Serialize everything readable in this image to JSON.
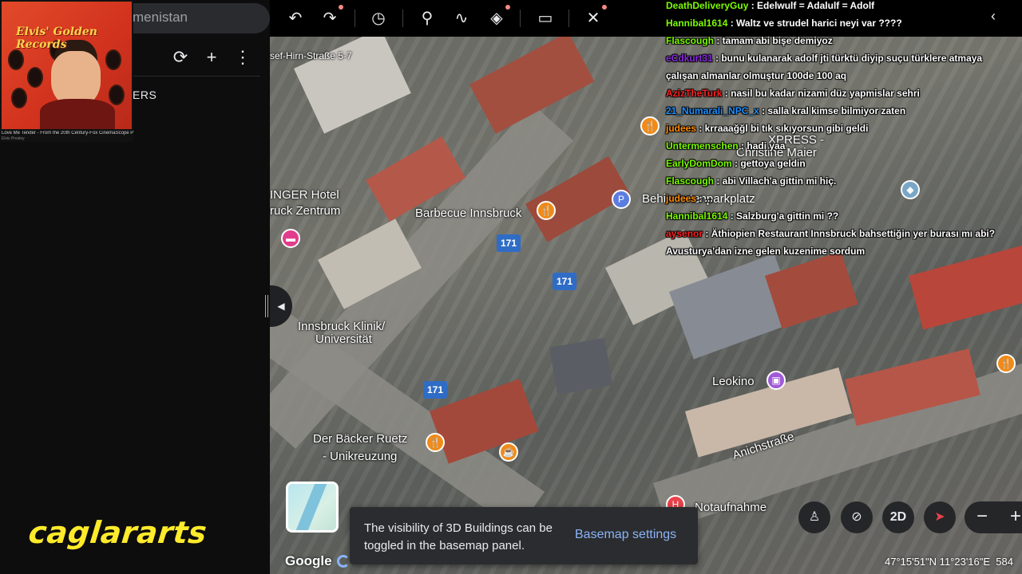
{
  "panel": {
    "search_text": "menistan",
    "projects_header": "ERS",
    "refresh_icon": "refresh-icon",
    "add_icon": "plus-icon",
    "more_icon": "more-vert-icon"
  },
  "album": {
    "title": "Elvis' Golden Records",
    "caption": "Love Me Tender - From the 20th Century-Fox CinemaScope Produc",
    "sub": "Elvis Presley"
  },
  "brand": {
    "text": "caglararts"
  },
  "toolbar": {
    "tools": [
      "undo-icon",
      "redo-icon",
      "history-icon",
      "place-pin-icon",
      "path-icon",
      "layers-icon",
      "ruler-icon",
      "settings-tools-icon"
    ]
  },
  "map": {
    "labels": {
      "street_top": "sef-Hirn-Straße 5-7",
      "bbq": "Barbecue Innsbruck",
      "hotel_line1": "INGER Hotel",
      "hotel_line2": "ruck Zentrum",
      "parking": "Behindertenparkplatz",
      "klinik_line1": "Innsbruck Klinik/",
      "klinik_line2": "Universität",
      "leokino": "Leokino",
      "baecker_line1": "Der Bäcker Ruetz",
      "baecker_line2": "- Unikreuzung",
      "anich": "Anichstraße",
      "notaufnahme": "Notaufnahme",
      "xpress": "XPRESS -",
      "maier": "Christine Maier"
    },
    "shields": [
      "171",
      "171",
      "171"
    ],
    "parking_letter": "P"
  },
  "toast": {
    "text": "The visibility of 3D Buildings can be toggled in the basemap panel.",
    "link": "Basemap settings"
  },
  "footer": {
    "google": "Google",
    "coords": "47°15'51\"N 11°23'16\"E",
    "alt": "584"
  },
  "controls": {
    "mode_2d": "2D",
    "zoom_out": "−",
    "zoom_in": "+"
  },
  "chat": [
    {
      "user": "DeathDeliveryGuy",
      "color": "#7CFC00",
      "msg": " : Edelwulf = Adalulf = Adolf"
    },
    {
      "user": "Hannibal1614",
      "color": "#7CFC00",
      "msg": " : Waltz ve strudel harici neyi var ????"
    },
    {
      "user": "Flascough",
      "color": "#7CFC00",
      "msg": " : tamam abi bişe demiyoz"
    },
    {
      "user": "eCdkurt31",
      "color": "#8a2be2",
      "msg": " : bunu kulanarak adolf jti türktü diyip suçu türklere atmaya çalışan almanlar olmuştur 100de 100 aq"
    },
    {
      "user": "AzizTheTurk",
      "color": "#ff2020",
      "msg": " : nasil bu kadar nizami düz yapmislar sehri"
    },
    {
      "user": "21_Numarali_NPC_x",
      "color": "#1e90ff",
      "msg": " : salla kral kimse bilmiyor zaten"
    },
    {
      "user": "judees",
      "color": "#ff8c00",
      "msg": " : krraaağğl bi tık sıkıyorsun gibi geldi"
    },
    {
      "user": "Untermenschen",
      "color": "#7CFC00",
      "msg": " : hadi yaa"
    },
    {
      "user": "EarlyDomDom",
      "color": "#7CFC00",
      "msg": " : gettoya geldin"
    },
    {
      "user": "Flascough",
      "color": "#7CFC00",
      "msg": " : abi Villach'a gittin mi hiç."
    },
    {
      "user": "judees",
      "color": "#ff8c00",
      "msg": " : ..."
    },
    {
      "user": "Hannibal1614",
      "color": "#7CFC00",
      "msg": " : Salzburg'a gittin mi ??"
    },
    {
      "user": "aysenor",
      "color": "#ff2020",
      "msg": " : Äthiopien Restaurant Innsbruck bahsettiğin yer burası mı abi? Avusturya'dan izne gelen kuzenime sordum"
    }
  ],
  "colors": {
    "accent": "#8ab4f8",
    "brand": "#ffeb2a",
    "shield": "#2f6cc5"
  }
}
